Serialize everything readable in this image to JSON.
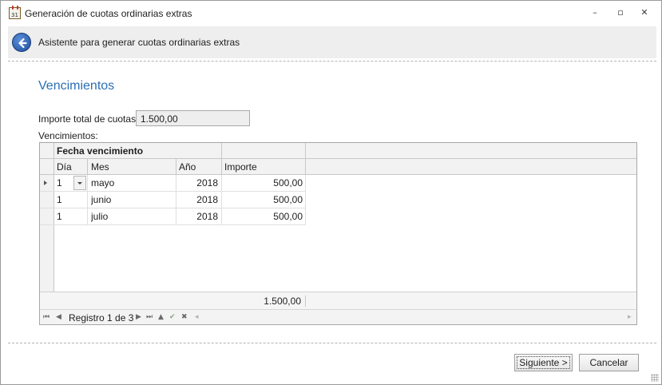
{
  "window": {
    "title": "Generación de cuotas ordinarias extras",
    "icon": "calendar-icon",
    "icon_day": "31",
    "controls": {
      "minimize": "–",
      "restore": "▫",
      "close": "✕"
    }
  },
  "header": {
    "title": "Asistente para generar cuotas ordinarias extras",
    "back_icon": "back-arrow-icon",
    "accent": "#2b6fb5"
  },
  "section": {
    "title": "Vencimientos"
  },
  "importe": {
    "label": "Importe total de cuotas:",
    "value": "1.500,00"
  },
  "vencimientos_label": "Vencimientos:",
  "grid": {
    "band": "Fecha vencimiento",
    "columns": {
      "dia": "Día",
      "mes": "Mes",
      "anio": "Año",
      "importe": "Importe"
    },
    "rows": [
      {
        "dia": "1",
        "mes": "mayo",
        "anio": "2018",
        "importe": "500,00"
      },
      {
        "dia": "1",
        "mes": "junio",
        "anio": "2018",
        "importe": "500,00"
      },
      {
        "dia": "1",
        "mes": "julio",
        "anio": "2018",
        "importe": "500,00"
      }
    ],
    "total": "1.500,00",
    "navigator": {
      "record_text": "Registro 1 de 3",
      "icons": [
        "first-icon",
        "prev-icon",
        "next-icon",
        "last-icon",
        "append-icon",
        "edit-icon",
        "confirm-icon",
        "cancel-edit-icon"
      ]
    }
  },
  "buttons": {
    "next": "Siguiente >",
    "cancel": "Cancelar"
  }
}
